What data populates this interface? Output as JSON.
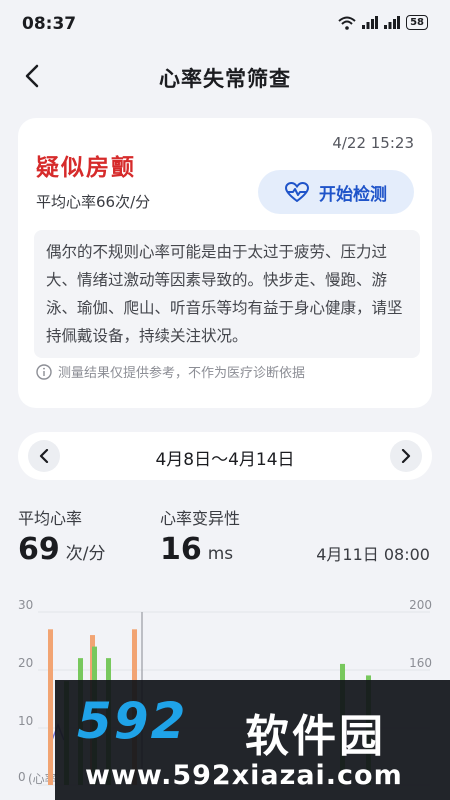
{
  "status": {
    "time": "08:37",
    "battery": "58"
  },
  "header": {
    "title": "心率失常筛查"
  },
  "card": {
    "datetime": "4/22 15:23",
    "result": "疑似房颤",
    "avg_line": "平均心率66次/分",
    "start_label": "开始检测",
    "tip": "偶尔的不规则心率可能是由于太过于疲劳、压力过大、情绪过激动等因素导致的。快步走、慢跑、游泳、瑜伽、爬山、听音乐等均有益于身心健康，请坚持佩戴设备，持续关注状况。",
    "disclaimer": "测量结果仅提供参考，不作为医疗诊断依据"
  },
  "range": {
    "label": "4月8日～4月14日"
  },
  "metrics": {
    "avg_label": "平均心率",
    "avg_value": "69",
    "avg_unit": "次/分",
    "hrv_label": "心率变异性",
    "hrv_value": "16",
    "hrv_unit": "ms",
    "selected_time": "4月11日 08:00"
  },
  "chart_data": {
    "type": "bar",
    "left_axis": {
      "ticks": [
        "30",
        "20",
        "10",
        "0"
      ],
      "range": [
        0,
        30
      ]
    },
    "right_axis": {
      "ticks": [
        "200",
        "160"
      ]
    },
    "bottom_note": "(心率",
    "series": [
      {
        "color": "#f2a473",
        "values": [
          27,
          0,
          0,
          26,
          0,
          0,
          27
        ]
      },
      {
        "color": "#78c85d",
        "values": [
          0,
          18,
          22,
          24,
          22,
          0,
          0
        ]
      }
    ],
    "extra_green": [
      21,
      19
    ],
    "cursor_index": 6
  },
  "watermark": {
    "logo": "592",
    "name": "软件园",
    "url": "www.592xiazai.com"
  },
  "colors": {
    "accent": "#1f54c9",
    "alert": "#d62b2b",
    "orange": "#f2a473",
    "green": "#78c85d"
  }
}
